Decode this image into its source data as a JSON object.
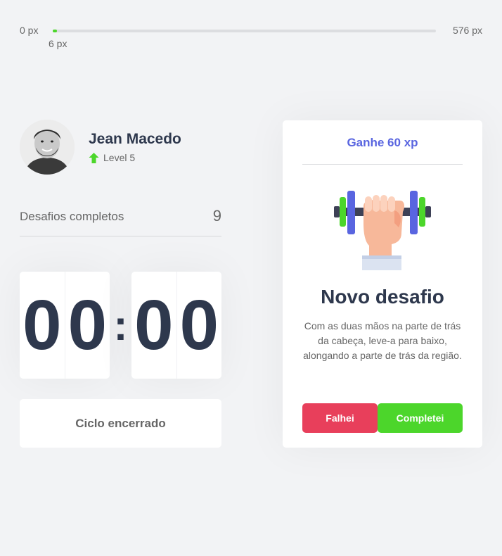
{
  "experience_bar": {
    "min_label": "0 px",
    "max_label": "576 px",
    "current_label": "6 px",
    "progress_percent": 1.04,
    "fill_color": "#4cd62b"
  },
  "profile": {
    "name": "Jean Macedo",
    "level": "Level 5",
    "level_icon": "arrow-up-icon"
  },
  "completed_challenges": {
    "label": "Desafios completos",
    "count": "9"
  },
  "countdown": {
    "minute_left": "0",
    "minute_right": "0",
    "separator": ":",
    "second_left": "0",
    "second_right": "0"
  },
  "cycle_button": {
    "label": "Ciclo encerrado"
  },
  "challenge_card": {
    "xp_label": "Ganhe 60 xp",
    "icon": "dumbbell-icon",
    "title": "Novo desafio",
    "description": "Com as duas mãos na parte de trás da cabeça, leve-a para baixo, alongando a parte de trás da região.",
    "fail_label": "Falhei",
    "complete_label": "Completei"
  },
  "colors": {
    "accent": "#5965e0",
    "success": "#4cd62b",
    "danger": "#e83f5b",
    "title": "#2e384d"
  }
}
